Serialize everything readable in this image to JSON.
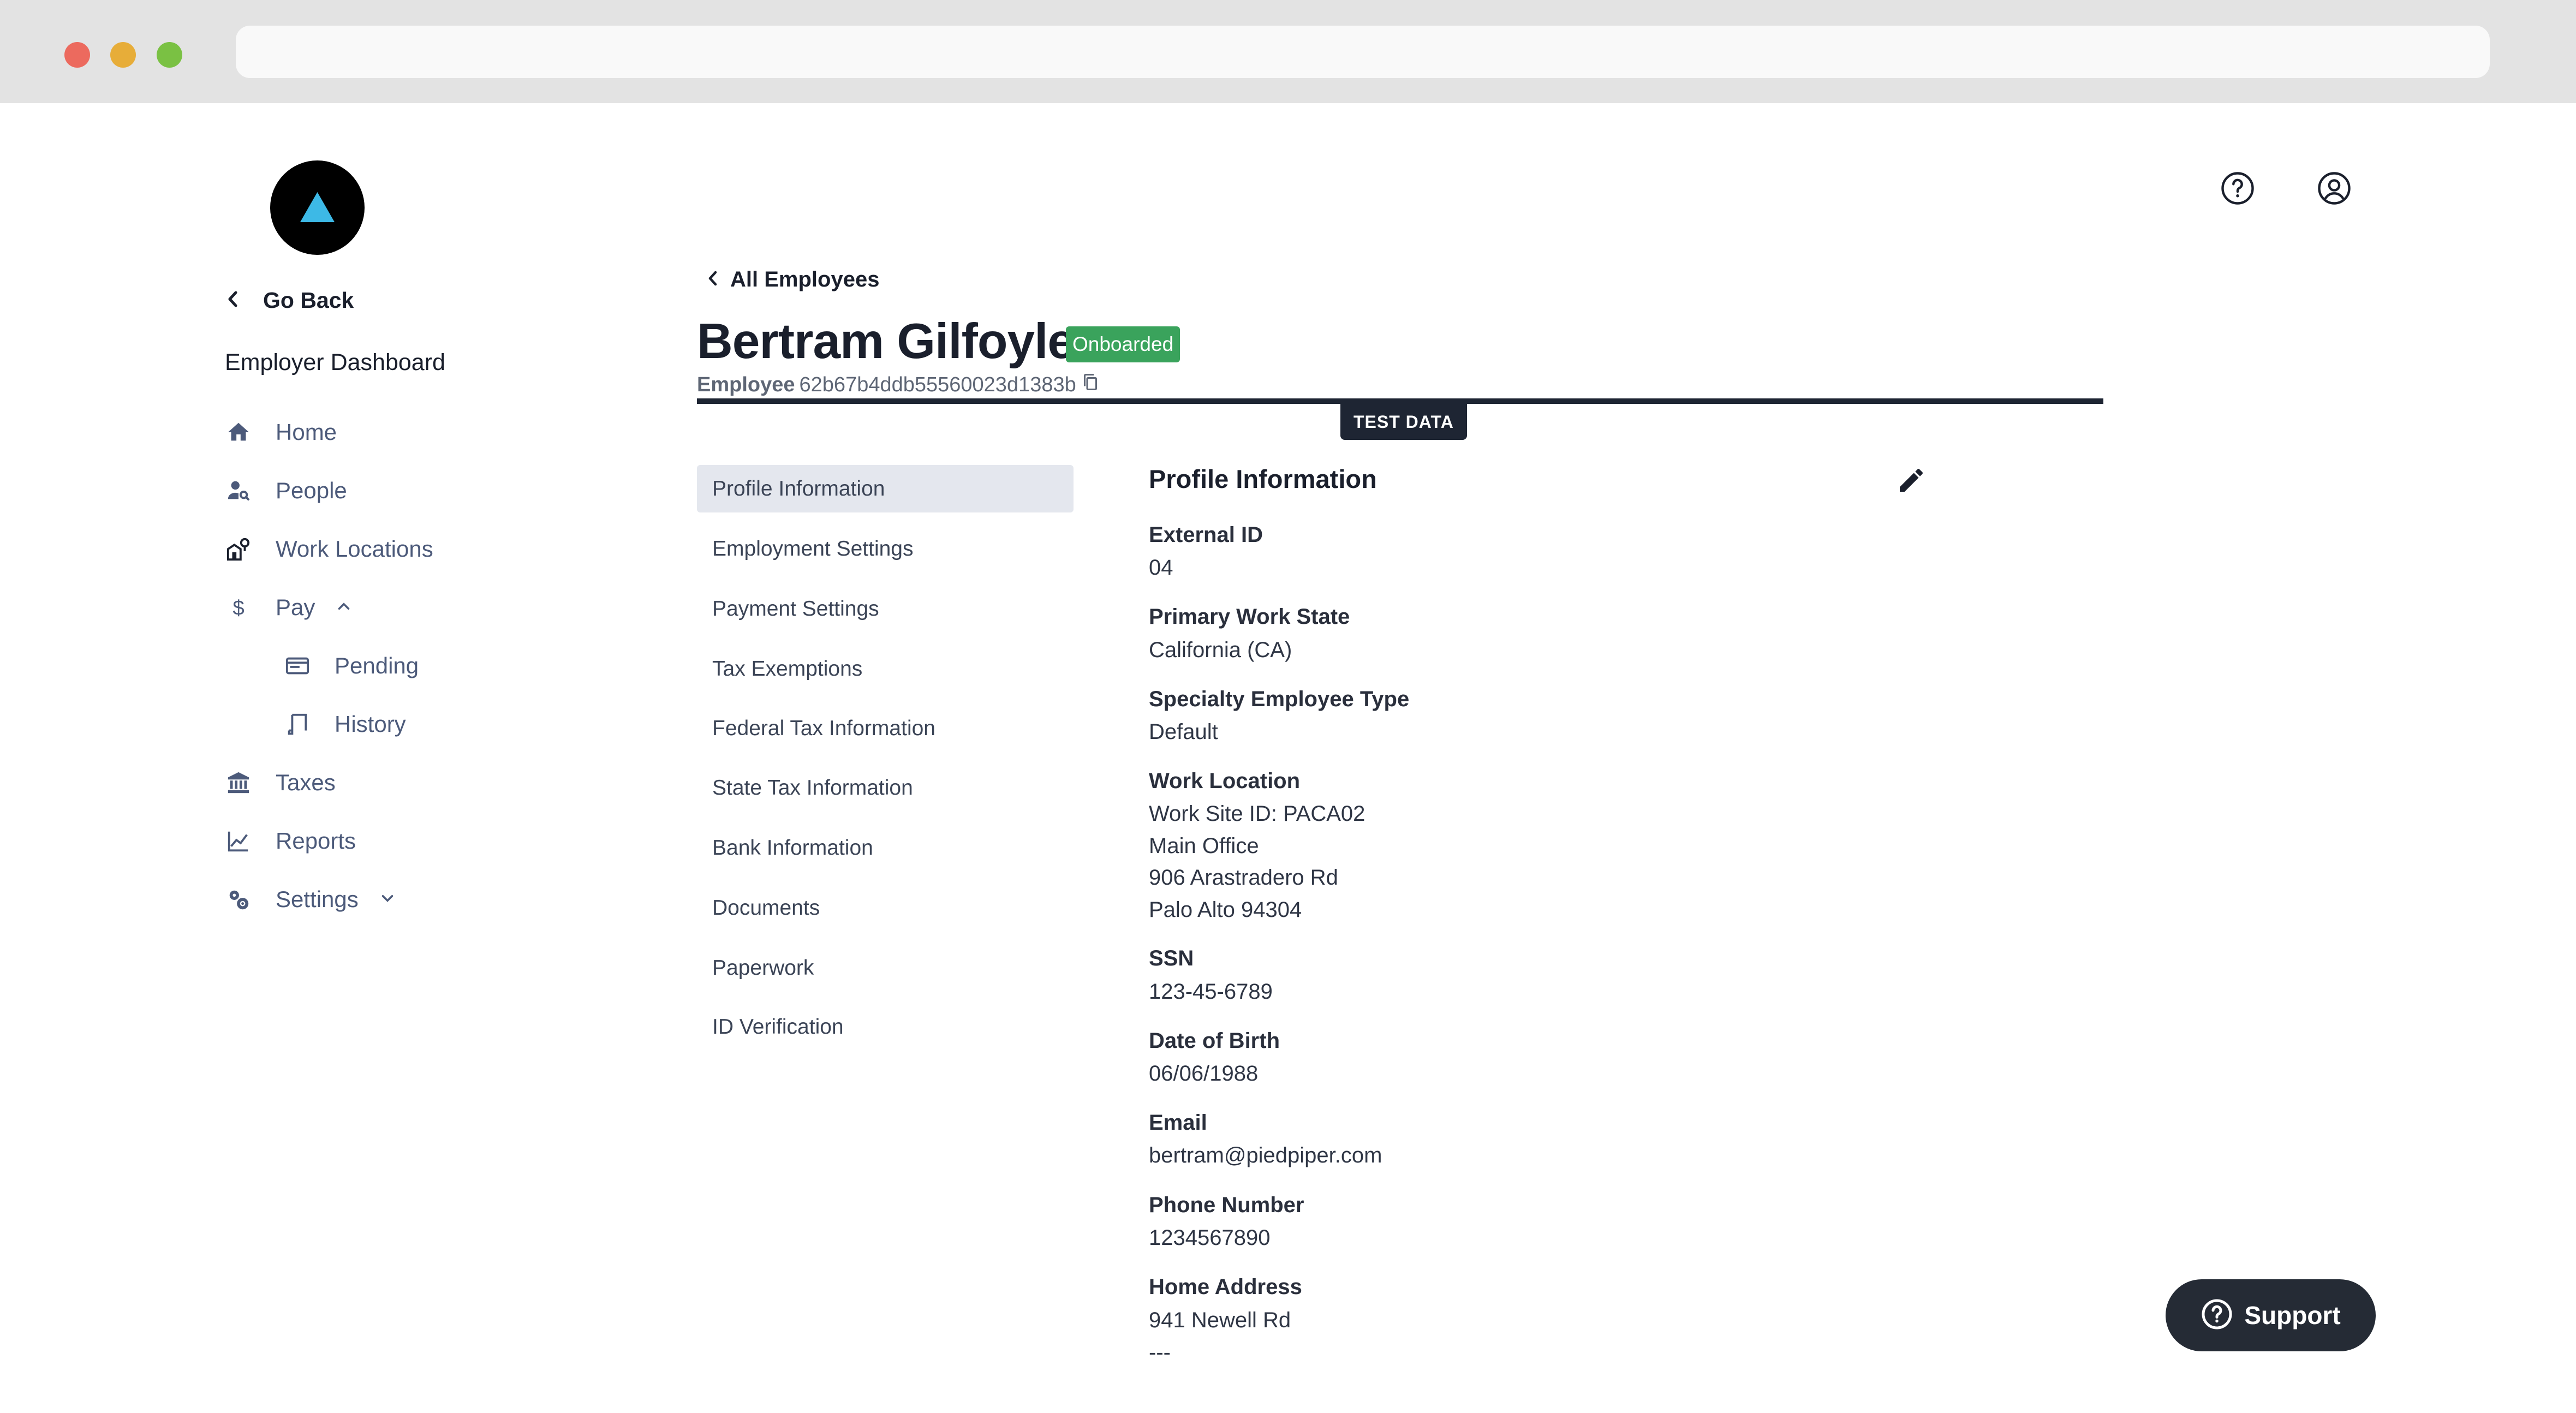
{
  "sidebar": {
    "go_back": "Go Back",
    "title": "Employer Dashboard",
    "items": [
      {
        "label": "Home"
      },
      {
        "label": "People"
      },
      {
        "label": "Work Locations"
      },
      {
        "label": "Pay"
      },
      {
        "label": "Pending"
      },
      {
        "label": "History"
      },
      {
        "label": "Taxes"
      },
      {
        "label": "Reports"
      },
      {
        "label": "Settings"
      }
    ]
  },
  "header": {
    "breadcrumb": "All Employees",
    "name": "Bertram Gilfoyle",
    "status": "Onboarded",
    "role": "Employee",
    "employee_id": "62b67b4ddb55560023d1383b",
    "test_data": "TEST DATA"
  },
  "subnav": [
    "Profile Information",
    "Employment Settings",
    "Payment Settings",
    "Tax Exemptions",
    "Federal Tax Information",
    "State Tax Information",
    "Bank Information",
    "Documents",
    "Paperwork",
    "ID Verification"
  ],
  "profile": {
    "title": "Profile Information",
    "fields": [
      {
        "label": "External ID",
        "value": "04"
      },
      {
        "label": "Primary Work State",
        "value": "California (CA)"
      },
      {
        "label": "Specialty Employee Type",
        "value": "Default"
      },
      {
        "label": "Work Location",
        "value": "Work Site ID: PACA02\nMain Office\n906 Arastradero Rd\nPalo Alto 94304"
      },
      {
        "label": "SSN",
        "value": "123-45-6789"
      },
      {
        "label": "Date of Birth",
        "value": "06/06/1988"
      },
      {
        "label": "Email",
        "value": "bertram@piedpiper.com"
      },
      {
        "label": "Phone Number",
        "value": "1234567890"
      },
      {
        "label": "Home Address",
        "value": "941 Newell Rd\n---"
      }
    ]
  },
  "support": {
    "label": "Support"
  },
  "icons": {
    "logo": "triangle-logo-icon",
    "help": "help-circle-icon",
    "account": "account-circle-icon",
    "edit": "pencil-icon",
    "copy": "copy-icon"
  },
  "colors": {
    "badge": "#3aa35c",
    "logo_triangle": "#3db9e6",
    "dark": "#1e2533",
    "active_tab": "#e4e7ee"
  }
}
